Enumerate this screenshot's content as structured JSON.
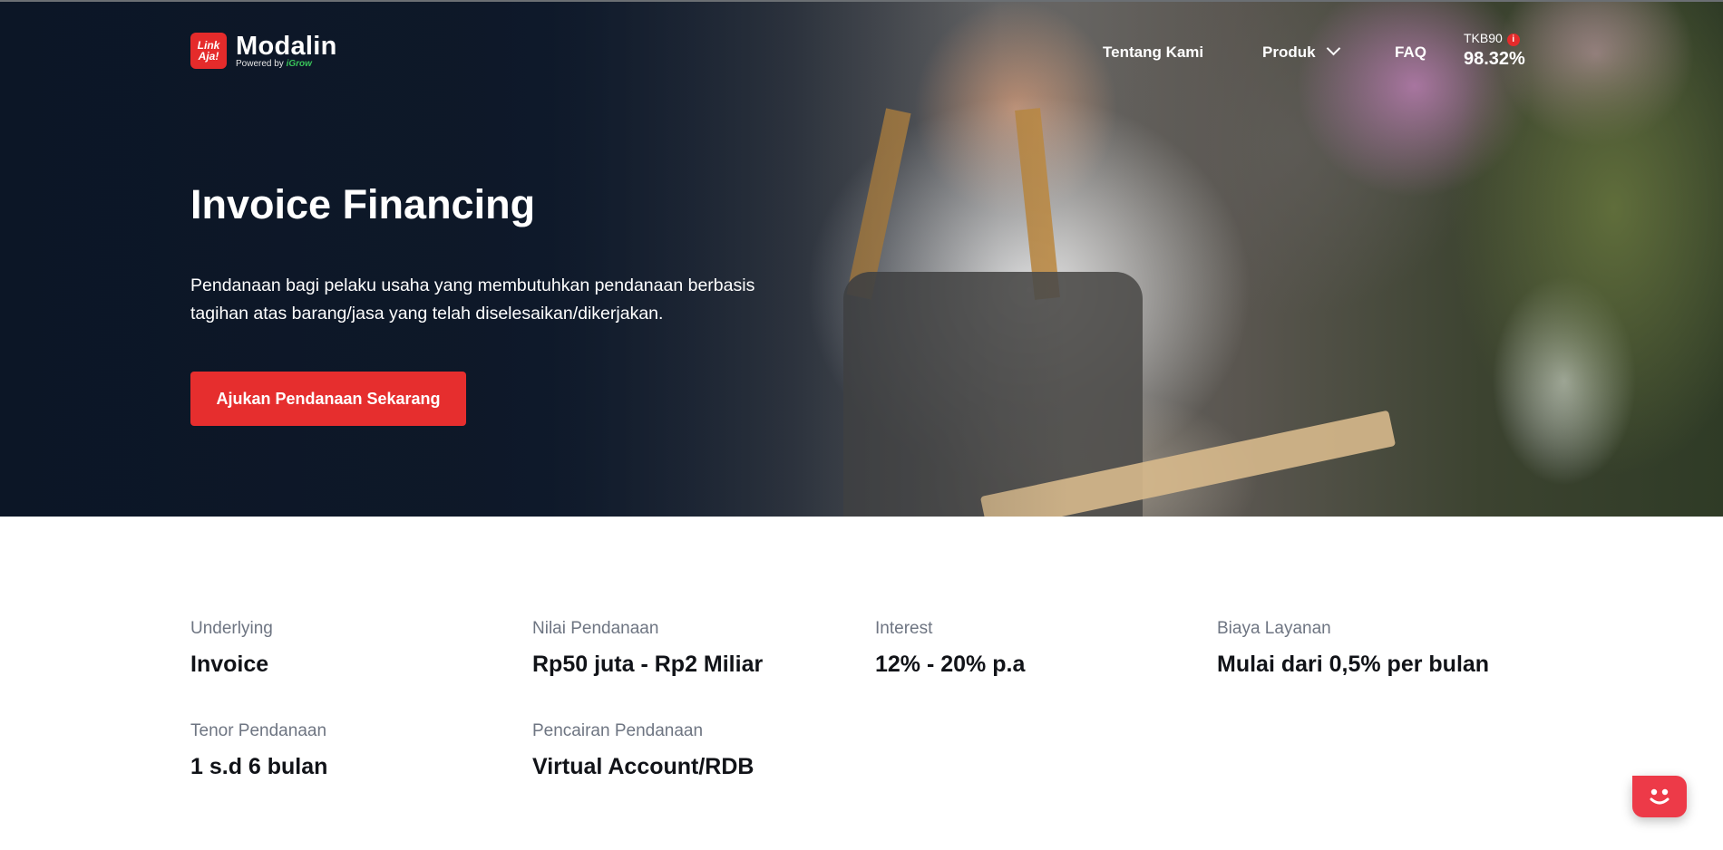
{
  "brand": {
    "badge_text": "Link Aja!",
    "name": "Modalin",
    "powered_by": "Powered by",
    "partner": "iGrow"
  },
  "nav": {
    "about": "Tentang Kami",
    "products": "Produk",
    "faq": "FAQ"
  },
  "tkb": {
    "label": "TKB90",
    "value": "98.32%"
  },
  "hero": {
    "title": "Invoice Financing",
    "description": "Pendanaan bagi pelaku usaha yang membutuhkan pendanaan berbasis tagihan atas barang/jasa yang telah diselesaikan/dikerjakan.",
    "cta": "Ajukan Pendanaan Sekarang"
  },
  "details": [
    {
      "label": "Underlying",
      "value": "Invoice"
    },
    {
      "label": "Nilai Pendanaan",
      "value": "Rp50 juta - Rp2 Miliar"
    },
    {
      "label": "Interest",
      "value": "12% - 20% p.a"
    },
    {
      "label": "Biaya Layanan",
      "value": "Mulai dari 0,5% per bulan"
    },
    {
      "label": "Tenor Pendanaan",
      "value": "1 s.d 6 bulan"
    },
    {
      "label": "Pencairan Pendanaan",
      "value": "Virtual Account/RDB"
    }
  ],
  "colors": {
    "accent": "#e62e2e",
    "hero_dark": "#0f1a2c",
    "label_gray": "#6e7582"
  },
  "icons": {
    "info": "info-icon",
    "chevron": "chevron-down-icon",
    "chat": "chat-bot-icon"
  }
}
